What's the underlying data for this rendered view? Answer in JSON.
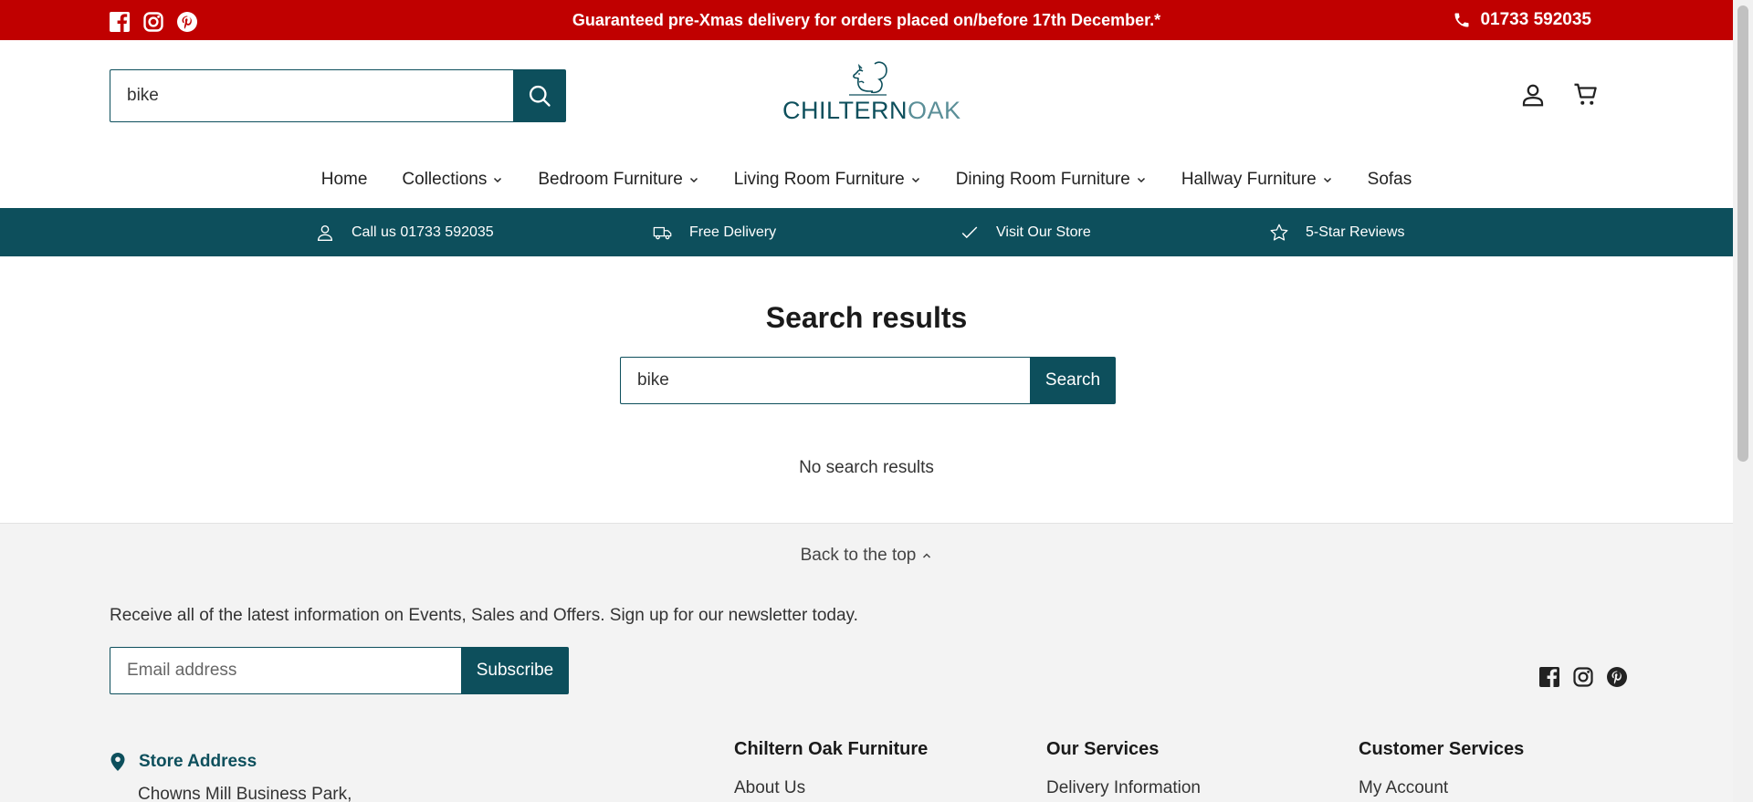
{
  "announcement": {
    "promo_text": "Guaranteed pre-Xmas delivery for orders placed on/before 17th December.*",
    "phone": "01733 592035",
    "social_icons": [
      "facebook-icon",
      "instagram-icon",
      "pinterest-icon"
    ],
    "color": "#c00000"
  },
  "header": {
    "search_value": "bike",
    "logo_text_dark": "CHILTERN",
    "logo_text_light": "OAK",
    "icons": [
      "account-icon",
      "cart-icon"
    ]
  },
  "nav": {
    "items": [
      {
        "label": "Home",
        "has_dropdown": false
      },
      {
        "label": "Collections",
        "has_dropdown": true
      },
      {
        "label": "Bedroom Furniture",
        "has_dropdown": true
      },
      {
        "label": "Living Room Furniture",
        "has_dropdown": true
      },
      {
        "label": "Dining Room Furniture",
        "has_dropdown": true
      },
      {
        "label": "Hallway Furniture",
        "has_dropdown": true
      },
      {
        "label": "Sofas",
        "has_dropdown": false
      }
    ]
  },
  "usp": {
    "items": [
      {
        "icon": "user-icon",
        "label": "Call us 01733 592035"
      },
      {
        "icon": "truck-icon",
        "label": "Free Delivery"
      },
      {
        "icon": "check-icon",
        "label": "Visit Our Store"
      },
      {
        "icon": "star-icon",
        "label": "5-Star Reviews"
      }
    ],
    "color": "#0d4f5c"
  },
  "main": {
    "title": "Search results",
    "search_value": "bike",
    "search_button": "Search",
    "no_results": "No search results"
  },
  "footer": {
    "back_to_top": "Back to the top",
    "newsletter_text": "Receive all of the latest information on Events, Sales and Offers. Sign up for our newsletter today.",
    "email_placeholder": "Email address",
    "subscribe_label": "Subscribe",
    "store_heading": "Store Address",
    "store_address_line1": "Chowns Mill Business Park,",
    "columns": [
      {
        "heading": "Chiltern Oak Furniture",
        "first_link": "About Us"
      },
      {
        "heading": "Our Services",
        "first_link": "Delivery Information"
      },
      {
        "heading": "Customer Services",
        "first_link": "My Account"
      }
    ]
  },
  "colors": {
    "brand_teal": "#0d4f5c",
    "announcement_red": "#c00000",
    "footer_bg": "#f3f3f3"
  }
}
